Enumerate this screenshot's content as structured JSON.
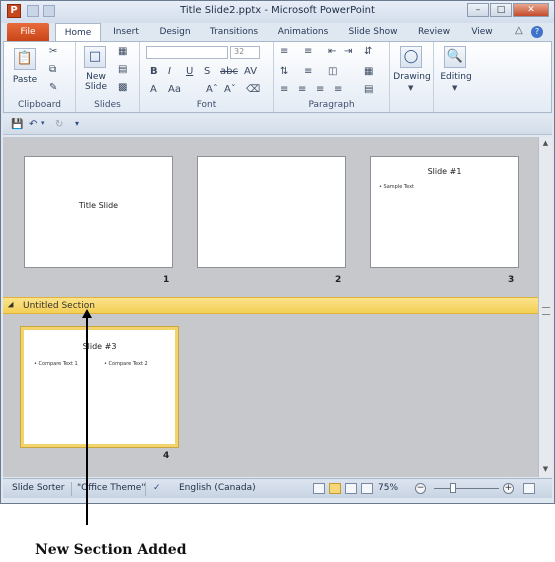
{
  "window": {
    "title": "Title Slide2.pptx - Microsoft PowerPoint",
    "app_icon": "P",
    "minimize_icon": "minimize-icon",
    "maximize_icon": "maximize-icon",
    "close_icon": "close-icon"
  },
  "tabs": [
    {
      "label": "File"
    },
    {
      "label": "Home"
    },
    {
      "label": "Insert"
    },
    {
      "label": "Design"
    },
    {
      "label": "Transitions"
    },
    {
      "label": "Animations"
    },
    {
      "label": "Slide Show"
    },
    {
      "label": "Review"
    },
    {
      "label": "View"
    }
  ],
  "ribbon": {
    "clipboard": {
      "label": "Clipboard",
      "paste": "Paste"
    },
    "slides": {
      "label": "Slides",
      "new_slide": "New Slide"
    },
    "font": {
      "label": "Font",
      "size": "32",
      "bold": "B",
      "italic": "I",
      "underline": "U",
      "strike": "S",
      "abc": "abc",
      "av": "AV",
      "aa": "Aa",
      "a_color": "A"
    },
    "paragraph": {
      "label": "Paragraph"
    },
    "drawing": {
      "label": "Drawing"
    },
    "editing": {
      "label": "Editing"
    }
  },
  "slides": [
    {
      "number": "1",
      "title": "Title Slide",
      "bullets": []
    },
    {
      "number": "2",
      "title": "",
      "bullets": []
    },
    {
      "number": "3",
      "title": "Slide #1",
      "bullets": [
        "Sample Text"
      ]
    },
    {
      "number": "4",
      "title": "Slide #3",
      "bullets": [
        "Compare Text 1",
        "Compare Text 2"
      ]
    }
  ],
  "section": {
    "name": "Untitled Section"
  },
  "statusbar": {
    "view": "Slide Sorter",
    "theme": "\"Office Theme\"",
    "language": "English (Canada)",
    "zoom": "75%",
    "zoom_level": 75
  },
  "annotation": {
    "text": "New Section Added"
  },
  "colors": {
    "section_bar": "#f4cf56",
    "file_tab": "#c94516",
    "selected_border": "#f3d36c"
  }
}
